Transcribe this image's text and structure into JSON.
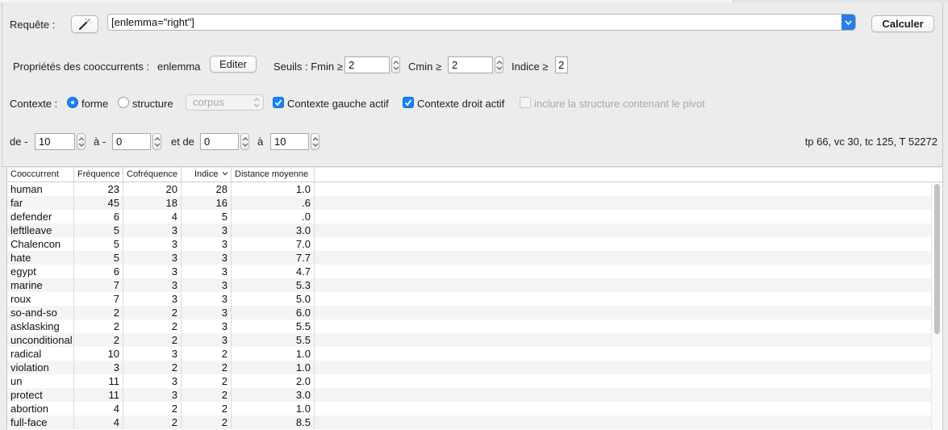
{
  "query": {
    "label": "Requête :",
    "value": "[enlemma=\"right\"]",
    "calc_button": "Calculer"
  },
  "properties": {
    "label": "Propriétés des cooccurrents :",
    "value": "enlemma",
    "edit_button": "Editer",
    "thresholds_label": "Seuils : Fmin ≥",
    "fmin": "2",
    "cmin_label": "Cmin ≥",
    "cmin": "2",
    "indice_label": "Indice ≥",
    "indice": "2"
  },
  "context": {
    "label": "Contexte :",
    "radio_forme": "forme",
    "radio_structure": "structure",
    "structure_select": "corpus",
    "left_context": "Contexte gauche actif",
    "right_context": "Contexte droit actif",
    "include_structure": "inclure la structure contenant le pivot"
  },
  "range": {
    "de_label": "de -",
    "de_value": "10",
    "a_label": "à -",
    "a_value": "0",
    "et_de_label": "et de",
    "et_de_value": "0",
    "a2_label": "à",
    "a2_value": "10",
    "stats": "tp 66, vc 30, tc 125, T 52272"
  },
  "table": {
    "headers": [
      "Cooccurrent",
      "Fréquence",
      "Cofréquence",
      "Indice",
      "Distance moyenne"
    ],
    "rows": [
      [
        "human",
        "23",
        "20",
        "28",
        "1.0"
      ],
      [
        "far",
        "45",
        "18",
        "16",
        ".6"
      ],
      [
        "defender",
        "6",
        "4",
        "5",
        ".0"
      ],
      [
        "leftlleave",
        "5",
        "3",
        "3",
        "3.0"
      ],
      [
        "Chalencon",
        "5",
        "3",
        "3",
        "7.0"
      ],
      [
        "hate",
        "5",
        "3",
        "3",
        "7.7"
      ],
      [
        "egypt",
        "6",
        "3",
        "3",
        "4.7"
      ],
      [
        "marine",
        "7",
        "3",
        "3",
        "5.3"
      ],
      [
        "roux",
        "7",
        "3",
        "3",
        "5.0"
      ],
      [
        "so-and-so",
        "2",
        "2",
        "3",
        "6.0"
      ],
      [
        "asklasking",
        "2",
        "2",
        "3",
        "5.5"
      ],
      [
        "unconditional",
        "2",
        "2",
        "3",
        "5.5"
      ],
      [
        "radical",
        "10",
        "3",
        "2",
        "1.0"
      ],
      [
        "violation",
        "3",
        "2",
        "2",
        "1.0"
      ],
      [
        "un",
        "11",
        "3",
        "2",
        "2.0"
      ],
      [
        "protect",
        "11",
        "3",
        "2",
        "3.0"
      ],
      [
        "abortion",
        "4",
        "2",
        "2",
        "1.0"
      ],
      [
        "full-face",
        "4",
        "2",
        "2",
        "8.5"
      ]
    ]
  },
  "icons": {
    "wizard": "magic-wand-icon",
    "sort": "chevron-down-icon",
    "accent": "#1a82f7"
  }
}
